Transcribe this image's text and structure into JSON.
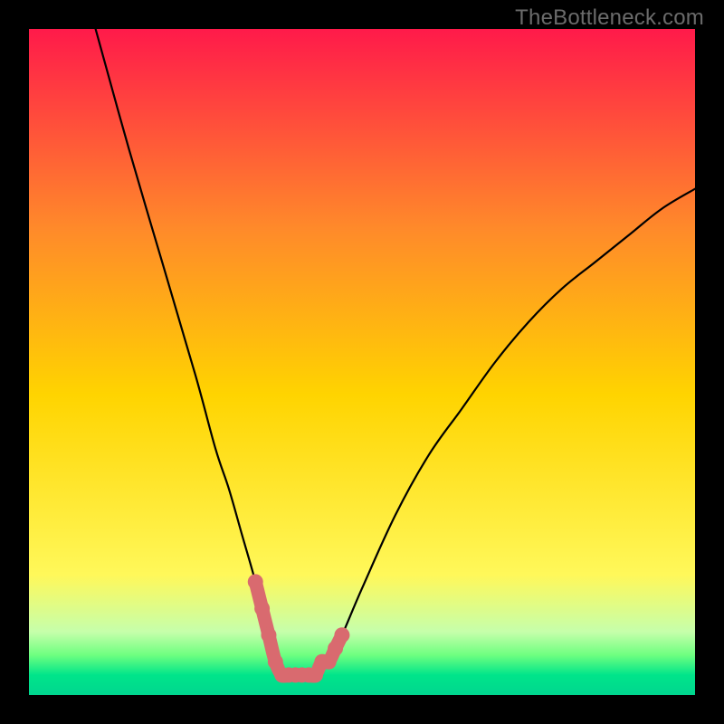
{
  "watermark": "TheBottleneck.com",
  "colors": {
    "frame": "#000000",
    "gradient_top": "#ff1a4a",
    "gradient_mid_upper": "#ff8a2a",
    "gradient_mid": "#ffd400",
    "gradient_lower": "#fff85a",
    "gradient_palegreen": "#c6ffab",
    "gradient_green1": "#6eff80",
    "gradient_green2": "#00e58a",
    "gradient_bottom": "#00d68f",
    "curve": "#000000",
    "highlight": "#d96a6f"
  },
  "chart_data": {
    "type": "line",
    "title": "",
    "xlabel": "",
    "ylabel": "",
    "xlim": [
      0,
      100
    ],
    "ylim": [
      0,
      100
    ],
    "grid": false,
    "legend": false,
    "note": "Axes are normalized 0–100; values estimated from pixel positions.",
    "series": [
      {
        "name": "bottleneck-curve",
        "x": [
          10,
          15,
          20,
          25,
          28,
          30,
          32,
          34,
          36,
          37,
          38,
          39,
          41,
          43,
          45,
          47,
          50,
          55,
          60,
          65,
          70,
          75,
          80,
          85,
          90,
          95,
          100
        ],
        "y": [
          100,
          82,
          65,
          48,
          37,
          31,
          24,
          17,
          9,
          5,
          3,
          3,
          3,
          3,
          5,
          9,
          16,
          27,
          36,
          43,
          50,
          56,
          61,
          65,
          69,
          73,
          76
        ]
      },
      {
        "name": "highlight-segment",
        "x": [
          34,
          35,
          36,
          37,
          38,
          39,
          40,
          41,
          42,
          43,
          44,
          45,
          46,
          47
        ],
        "y": [
          17,
          13,
          9,
          5,
          3,
          3,
          3,
          3,
          3,
          3,
          5,
          5,
          7,
          9
        ]
      }
    ]
  }
}
